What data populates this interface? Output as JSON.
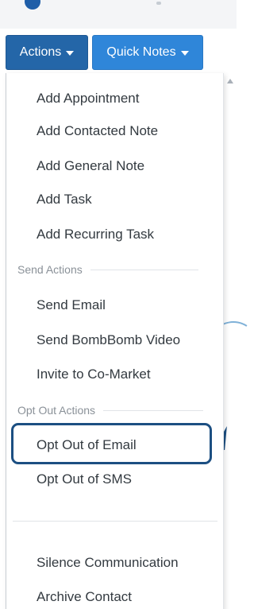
{
  "toolbar": {
    "actions_label": "Actions",
    "quick_notes_label": "Quick Notes"
  },
  "menu": {
    "items_group_1": [
      {
        "label": "Add Appointment"
      },
      {
        "label": "Add Contacted Note"
      },
      {
        "label": "Add General Note"
      },
      {
        "label": "Add Task"
      },
      {
        "label": "Add Recurring Task"
      }
    ],
    "send_actions": {
      "header": "Send Actions",
      "items": [
        {
          "label": "Send Email"
        },
        {
          "label": "Send BombBomb Video"
        },
        {
          "label": "Invite to Co-Market"
        }
      ]
    },
    "opt_out_actions": {
      "header": "Opt Out Actions",
      "items": [
        {
          "label": "Opt Out of Email",
          "highlighted": true
        },
        {
          "label": "Opt Out of SMS"
        }
      ]
    },
    "items_group_4": [
      {
        "label": "Silence Communication"
      },
      {
        "label": "Archive Contact"
      }
    ]
  },
  "colors": {
    "actions_button": "#2466a8",
    "quick_notes_button": "#2f86d9",
    "highlight_border": "#1c4f82",
    "menu_text": "#333a40",
    "header_text": "#8a9198"
  },
  "icons": {
    "dropdown_caret": "caret-down-icon",
    "scroll_up": "scroll-up-arrow-icon"
  }
}
